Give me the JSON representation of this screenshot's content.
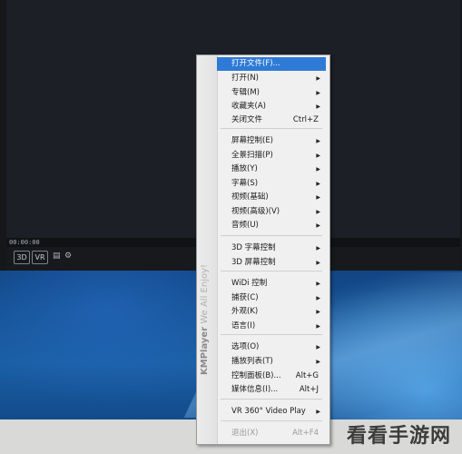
{
  "player": {
    "time": "00:00:00",
    "buttons": {
      "three_d": "3D",
      "vr": "VR"
    }
  },
  "menu": {
    "side_label_brand": "KMPlayer",
    "side_label_tagline": "We All Enjoy!",
    "items": [
      {
        "label": "打开文件(F)...",
        "shortcut": "",
        "arrow": false,
        "highlighted": true,
        "disabled": false
      },
      {
        "label": "打开(N)",
        "shortcut": "",
        "arrow": true,
        "highlighted": false,
        "disabled": false
      },
      {
        "label": "专辑(M)",
        "shortcut": "",
        "arrow": true,
        "highlighted": false,
        "disabled": false
      },
      {
        "label": "收藏夹(A)",
        "shortcut": "",
        "arrow": true,
        "highlighted": false,
        "disabled": false
      },
      {
        "label": "关闭文件",
        "shortcut": "Ctrl+Z",
        "arrow": false,
        "highlighted": false,
        "disabled": false
      },
      {
        "label": "屏幕控制(E)",
        "shortcut": "",
        "arrow": true,
        "highlighted": false,
        "disabled": false
      },
      {
        "label": "全景扫描(P)",
        "shortcut": "",
        "arrow": true,
        "highlighted": false,
        "disabled": false
      },
      {
        "label": "播放(Y)",
        "shortcut": "",
        "arrow": true,
        "highlighted": false,
        "disabled": false
      },
      {
        "label": "字幕(S)",
        "shortcut": "",
        "arrow": true,
        "highlighted": false,
        "disabled": false
      },
      {
        "label": "视频(基础)",
        "shortcut": "",
        "arrow": true,
        "highlighted": false,
        "disabled": false
      },
      {
        "label": "视频(高级)(V)",
        "shortcut": "",
        "arrow": true,
        "highlighted": false,
        "disabled": false
      },
      {
        "label": "音频(U)",
        "shortcut": "",
        "arrow": true,
        "highlighted": false,
        "disabled": false
      },
      {
        "label": "3D 字幕控制",
        "shortcut": "",
        "arrow": true,
        "highlighted": false,
        "disabled": false
      },
      {
        "label": "3D 屏幕控制",
        "shortcut": "",
        "arrow": true,
        "highlighted": false,
        "disabled": false
      },
      {
        "label": "WiDi 控制",
        "shortcut": "",
        "arrow": true,
        "highlighted": false,
        "disabled": false
      },
      {
        "label": "捕获(C)",
        "shortcut": "",
        "arrow": true,
        "highlighted": false,
        "disabled": false
      },
      {
        "label": "外观(K)",
        "shortcut": "",
        "arrow": true,
        "highlighted": false,
        "disabled": false
      },
      {
        "label": "语言(I)",
        "shortcut": "",
        "arrow": true,
        "highlighted": false,
        "disabled": false
      },
      {
        "label": "选项(O)",
        "shortcut": "",
        "arrow": true,
        "highlighted": false,
        "disabled": false
      },
      {
        "label": "播放列表(T)",
        "shortcut": "",
        "arrow": true,
        "highlighted": false,
        "disabled": false
      },
      {
        "label": "控制面板(B)...",
        "shortcut": "Alt+G",
        "arrow": false,
        "highlighted": false,
        "disabled": false
      },
      {
        "label": "媒体信息(I)...",
        "shortcut": "Alt+J",
        "arrow": false,
        "highlighted": false,
        "disabled": false
      },
      {
        "label": "VR 360° Video Play",
        "shortcut": "",
        "arrow": true,
        "highlighted": false,
        "disabled": false
      },
      {
        "label": "退出(X)",
        "shortcut": "Alt+F4",
        "arrow": false,
        "highlighted": false,
        "disabled": true
      }
    ]
  },
  "watermark": "看看手游网"
}
